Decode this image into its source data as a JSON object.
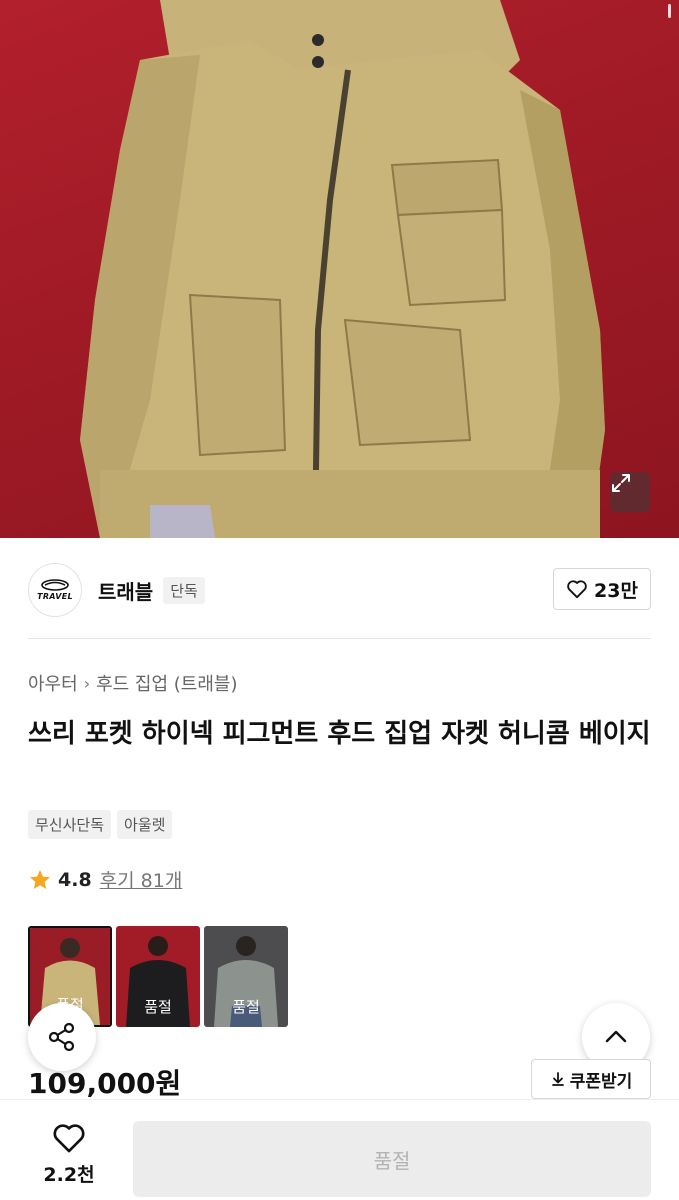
{
  "hero": {
    "image": "beige-hooded-zip-jacket-photo",
    "expand_icon": "expand-icon"
  },
  "brand": {
    "logo_text": "TRAVEL",
    "name": "트래블",
    "badge": "단독",
    "likes": "23만"
  },
  "breadcrumb": {
    "category": "아우터",
    "subcategory": "후드 집업 (트래블)"
  },
  "product": {
    "title": "쓰리 포켓 하이넥 피그먼트 후드 집업 자켓 허니콤 베이지",
    "tags": [
      "무신사단독",
      "아울렛"
    ],
    "rating": "4.8",
    "reviews": "후기 81개",
    "price": "109,000원"
  },
  "thumbnails": [
    {
      "name": "beige",
      "soldout": "품절",
      "selected": true
    },
    {
      "name": "black",
      "soldout": "품절",
      "selected": false
    },
    {
      "name": "gray",
      "soldout": "품절",
      "selected": false
    }
  ],
  "coupon": {
    "label": "쿠폰받기"
  },
  "bottom": {
    "wish_count": "2.2천",
    "buy_label": "품절"
  },
  "colors": {
    "star": "#f5a623",
    "hero_bg": "#a81d28",
    "disabled_btn": "#ececec"
  }
}
